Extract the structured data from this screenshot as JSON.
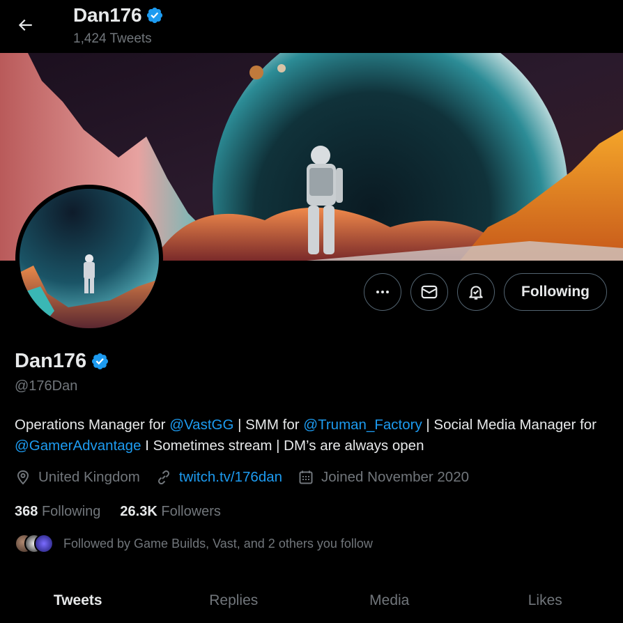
{
  "header": {
    "display_name": "Dan176",
    "tweet_count": "1,424 Tweets"
  },
  "icons": {
    "back": "arrow-left-icon",
    "verified": "verified-badge-icon",
    "more": "more-icon",
    "message": "message-icon",
    "notifications": "notification-bell-icon",
    "location": "location-icon",
    "link": "link-icon",
    "calendar": "calendar-icon"
  },
  "colors": {
    "accent": "#1d9bf0",
    "muted": "#71767b",
    "text": "#e7e9ea",
    "background": "#000000"
  },
  "actions": {
    "following_label": "Following"
  },
  "profile": {
    "name": "Dan176",
    "handle": "@176Dan",
    "bio": {
      "p1": "Operations Manager for ",
      "m1": "@VastGG",
      "p2": " | SMM for ",
      "m2": "@Truman_Factory",
      "p3": " | Social Media Manager for ",
      "m3": "@GamerAdvantage",
      "p4": " I Sometimes stream | DM’s are always open"
    },
    "location": "United Kingdom",
    "website": "twitch.tv/176dan",
    "joined": "Joined November 2020",
    "following_count": "368",
    "following_label": "Following",
    "followers_count": "26.3K",
    "followers_label": "Followers",
    "followed_by": "Followed by Game Builds, Vast, and 2 others you follow"
  },
  "tabs": [
    {
      "label": "Tweets",
      "active": true
    },
    {
      "label": "Replies",
      "active": false
    },
    {
      "label": "Media",
      "active": false
    },
    {
      "label": "Likes",
      "active": false
    }
  ]
}
